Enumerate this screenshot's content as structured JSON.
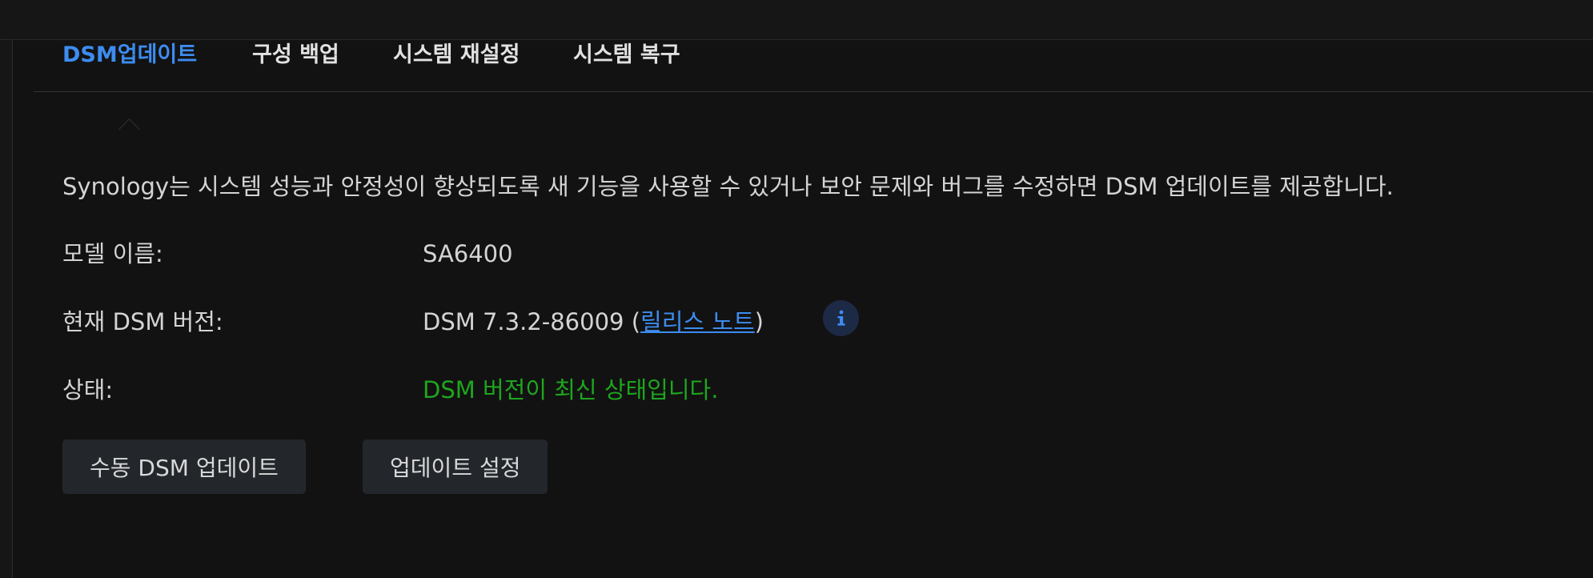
{
  "tabs": [
    {
      "label": "DSM업데이트",
      "active": true
    },
    {
      "label": "구성 백업",
      "active": false
    },
    {
      "label": "시스템 재설정",
      "active": false
    },
    {
      "label": "시스템 복구",
      "active": false
    }
  ],
  "description": "Synology는 시스템 성능과 안정성이 향상되도록 새 기능을 사용할 수 있거나 보안 문제와 버그를 수정하면 DSM 업데이트를 제공합니다.",
  "info": {
    "model_label": "모델 이름:",
    "model_value": "SA6400",
    "version_label": "현재 DSM 버전:",
    "version_value": "DSM 7.3.2-86009 (",
    "release_notes_link": "릴리스 노트",
    "version_suffix": ")",
    "info_icon_glyph": "i",
    "status_label": "상태:",
    "status_value": "DSM 버전이 최신 상태입니다.",
    "status_color": "#1ea61e"
  },
  "buttons": {
    "manual_update": "수동 DSM 업데이트",
    "update_settings": "업데이트 설정"
  },
  "colors": {
    "accent": "#3d8cf0",
    "background": "#121212"
  }
}
